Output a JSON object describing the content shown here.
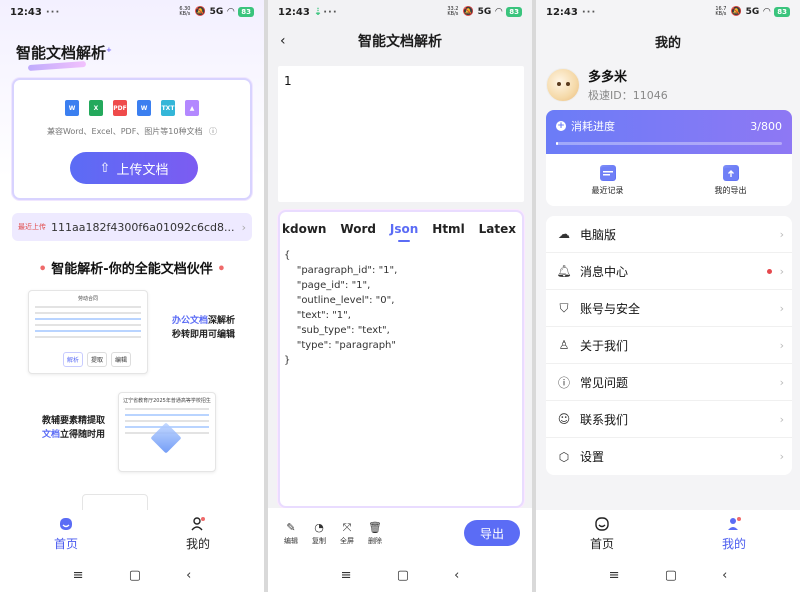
{
  "status": {
    "s1": {
      "time": "12:43",
      "speed_value": "6.30",
      "speed_unit": "KB/s",
      "battery": "83"
    },
    "s2": {
      "time": "12:43",
      "speed_value": "33.2",
      "speed_unit": "KB/s",
      "battery": "83"
    },
    "s3": {
      "time": "12:43",
      "speed_value": "16.7",
      "speed_unit": "KB/s",
      "battery": "83"
    },
    "dots": "···",
    "signal": "5G"
  },
  "home": {
    "app_title": "智能文档解析",
    "title_mark": "+",
    "file_types": [
      {
        "label": "W",
        "color": "#3b7ff0"
      },
      {
        "label": "X",
        "color": "#24a95c"
      },
      {
        "label": "PDF",
        "color": "#ef4b4b"
      },
      {
        "label": "W",
        "color": "#3b7ff0"
      },
      {
        "label": "TXT",
        "color": "#34b6d8"
      },
      {
        "label": "▲",
        "color": "#b388ff"
      }
    ],
    "support_text": "兼容Word、Excel、PDF、图片等10种文档",
    "help_icon": "ⓘ",
    "upload_label": "上传文档",
    "recent_label": "最近上传",
    "recent_file": "111aa182f4300f6a01092c6cd8...",
    "slogan_main": "智能解析-你的全能文档伙伴",
    "slogan_bullet": "•",
    "promo1": {
      "doc_title": "劳动合同",
      "chip_parse": "解析",
      "chip_extract": "提取",
      "chip_edit": "编辑",
      "text_line1_hl": "办公文档",
      "text_line1": "深解析",
      "text_line2": "秒转即用可编辑"
    },
    "promo2": {
      "doc_title": "辽宁省教育厅2025年普通高等学校招生",
      "text_line1": "教辅要素精提取",
      "text_line2_hl": "文档",
      "text_line2": "立得随时用"
    }
  },
  "tabs": {
    "home": "首页",
    "mine": "我的"
  },
  "sys": {
    "menu": "≡",
    "home": "▢",
    "back": "‹"
  },
  "parse": {
    "back": "‹",
    "title": "智能文档解析",
    "editor_text": "1",
    "formats": [
      "kdown",
      "Word",
      "Json",
      "Html",
      "Latex"
    ],
    "active_format": "Json",
    "json_text": "{\n    \"paragraph_id\": \"1\",\n    \"page_id\": \"1\",\n    \"outline_level\": \"0\",\n    \"text\": \"1\",\n    \"sub_type\": \"text\",\n    \"type\": \"paragraph\"\n}",
    "tools": [
      {
        "label": "编辑",
        "glyph": "✎"
      },
      {
        "label": "复制",
        "glyph": "◔"
      },
      {
        "label": "全屏",
        "glyph": "⤧"
      },
      {
        "label": "删除",
        "glyph": "🗑"
      }
    ],
    "export_label": "导出"
  },
  "mine": {
    "title": "我的",
    "username": "多多米",
    "user_id": "极速ID：11046",
    "consume_label": "消耗进度",
    "consume_count": "3/800",
    "progress_fraction": 0.00375,
    "quick": [
      {
        "label": "最近记录"
      },
      {
        "label": "我的导出"
      }
    ],
    "menu": [
      {
        "label": "电脑版",
        "icon": "☁"
      },
      {
        "label": "消息中心",
        "icon": "♫",
        "dot": true
      },
      {
        "label": "账号与安全",
        "icon": "⛉"
      },
      {
        "label": "关于我们",
        "icon": "♙"
      },
      {
        "label": "常见问题",
        "icon": "?"
      },
      {
        "label": "联系我们",
        "icon": "☺"
      },
      {
        "label": "设置",
        "icon": "⬡"
      }
    ],
    "chevron": "›",
    "accent": "#5b6cf5"
  }
}
